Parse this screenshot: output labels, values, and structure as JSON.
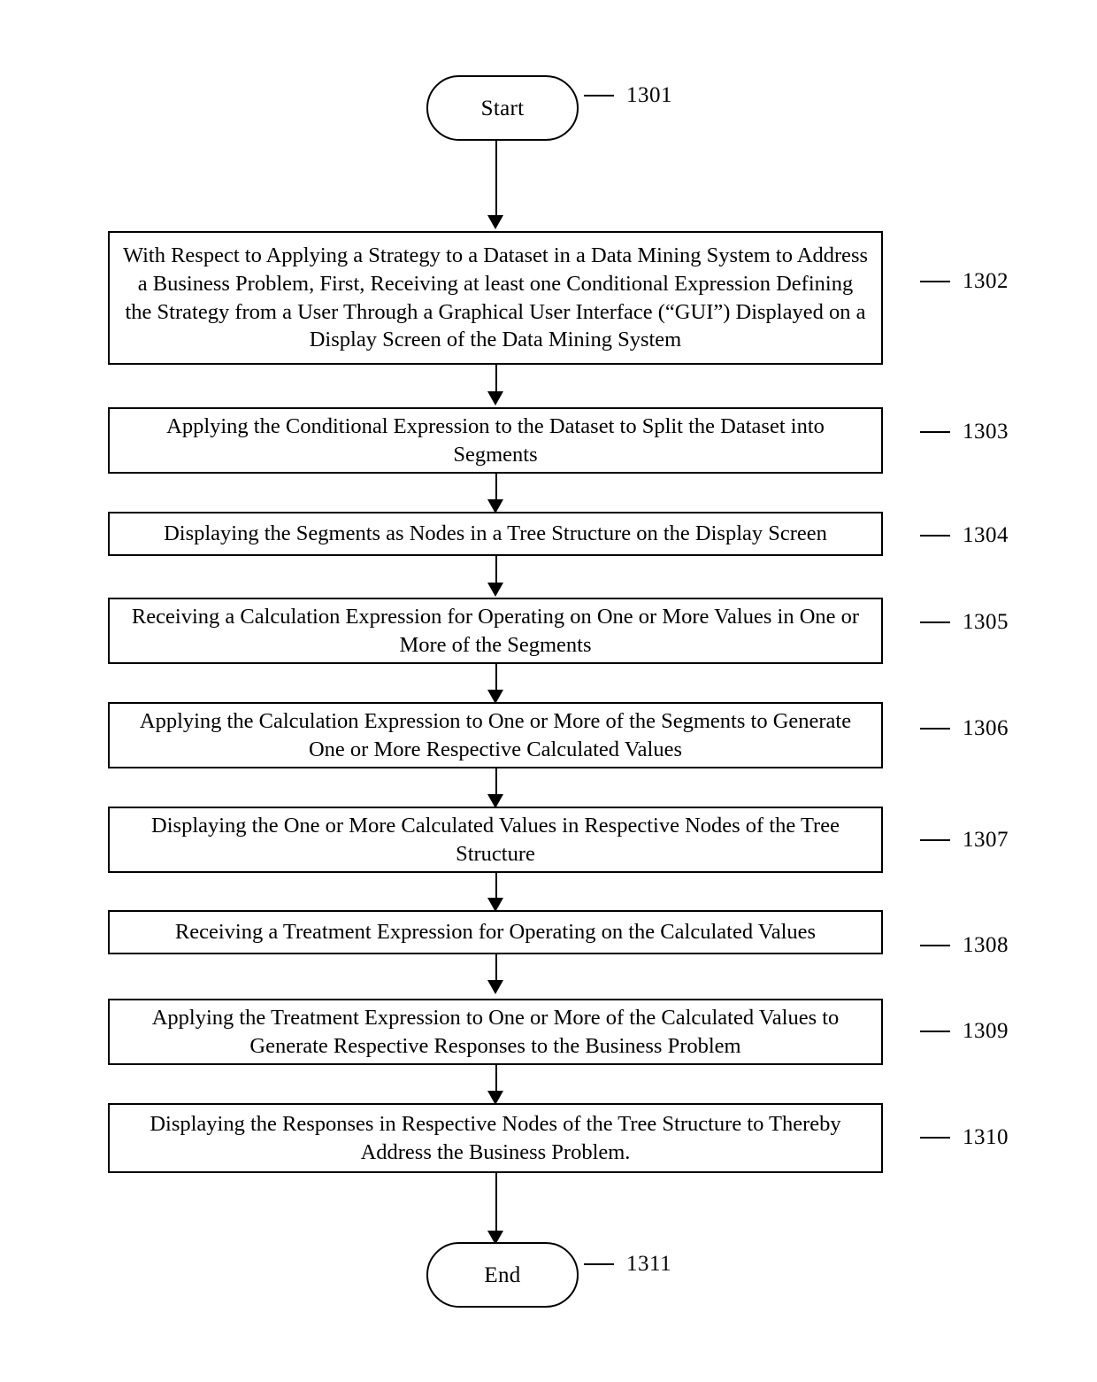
{
  "figure": {
    "type": "flowchart",
    "orientation": "vertical",
    "nodes": [
      {
        "id": "start",
        "shape": "terminator",
        "label": "Start",
        "ref": "1301"
      },
      {
        "id": "step-1302",
        "shape": "process",
        "label": "With Respect to Applying a Strategy to a Dataset in a Data Mining System to Address a Business Problem, First, Receiving at least one Conditional Expression Defining the Strategy from a User Through a Graphical User Interface (“GUI”) Displayed on a Display Screen of the Data Mining System",
        "ref": "1302"
      },
      {
        "id": "step-1303",
        "shape": "process",
        "label": "Applying the Conditional Expression to the Dataset to Split the Dataset into Segments",
        "ref": "1303"
      },
      {
        "id": "step-1304",
        "shape": "process",
        "label": "Displaying the Segments as Nodes in a Tree Structure on the Display Screen",
        "ref": "1304"
      },
      {
        "id": "step-1305",
        "shape": "process",
        "label": "Receiving a Calculation Expression for Operating on One or More Values in One or More of the Segments",
        "ref": "1305"
      },
      {
        "id": "step-1306",
        "shape": "process",
        "label": "Applying the Calculation Expression to One or More of the Segments to Generate One or More Respective Calculated Values",
        "ref": "1306"
      },
      {
        "id": "step-1307",
        "shape": "process",
        "label": "Displaying the One or More Calculated Values in Respective Nodes of the Tree Structure",
        "ref": "1307"
      },
      {
        "id": "step-1308",
        "shape": "process",
        "label": "Receiving a Treatment Expression for Operating on the Calculated Values",
        "ref": "1308"
      },
      {
        "id": "step-1309",
        "shape": "process",
        "label": "Applying the Treatment Expression to One or More of the Calculated Values to Generate Respective Responses to the Business Problem",
        "ref": "1309"
      },
      {
        "id": "step-1310",
        "shape": "process",
        "label": "Displaying the Responses in Respective Nodes of the Tree Structure to Thereby Address the Business Problem.",
        "ref": "1310"
      },
      {
        "id": "end",
        "shape": "terminator",
        "label": "End",
        "ref": "1311"
      }
    ],
    "colors": {
      "stroke": "#000000",
      "fill": "#ffffff",
      "text": "#000000"
    }
  }
}
